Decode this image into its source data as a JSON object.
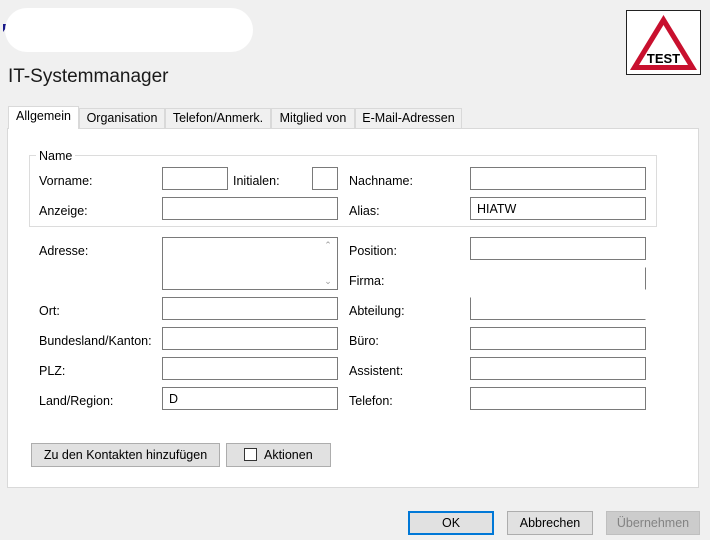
{
  "window": {
    "title": "IT-Systemmanager",
    "badge_text": "TEST"
  },
  "tabs": [
    {
      "label": "Allgemein",
      "active": true
    },
    {
      "label": "Organisation",
      "active": false
    },
    {
      "label": "Telefon/Anmerk.",
      "active": false
    },
    {
      "label": "Mitglied von",
      "active": false
    },
    {
      "label": "E-Mail-Adressen",
      "active": false
    }
  ],
  "name_group": {
    "legend": "Name",
    "first_name_label": "Vorname:",
    "first_name_value": "",
    "initials_label": "Initialen:",
    "initials_value": "",
    "last_name_label": "Nachname:",
    "last_name_value": "",
    "display_label": "Anzeige:",
    "display_value": "",
    "alias_label": "Alias:",
    "alias_value": "HIATW"
  },
  "left_fields": {
    "address_label": "Adresse:",
    "address_value": "",
    "city_label": "Ort:",
    "city_value": "",
    "state_label": "Bundesland/Kanton:",
    "state_value": "",
    "zip_label": "PLZ:",
    "zip_value": "",
    "country_label": "Land/Region:",
    "country_value": "D"
  },
  "right_fields": {
    "position_label": "Position:",
    "position_value": "",
    "company_label": "Firma:",
    "company_value": "",
    "department_label": "Abteilung:",
    "department_value": "",
    "office_label": "Büro:",
    "office_value": "",
    "assistant_label": "Assistent:",
    "assistant_value": "",
    "phone_label": "Telefon:",
    "phone_value": ""
  },
  "buttons": {
    "add_contacts": "Zu den Kontakten hinzufügen",
    "actions": "Aktionen",
    "ok": "OK",
    "cancel": "Abbrechen",
    "apply": "Übernehmen"
  },
  "colors": {
    "accent": "#0078d7",
    "badge_red": "#c8102e"
  }
}
